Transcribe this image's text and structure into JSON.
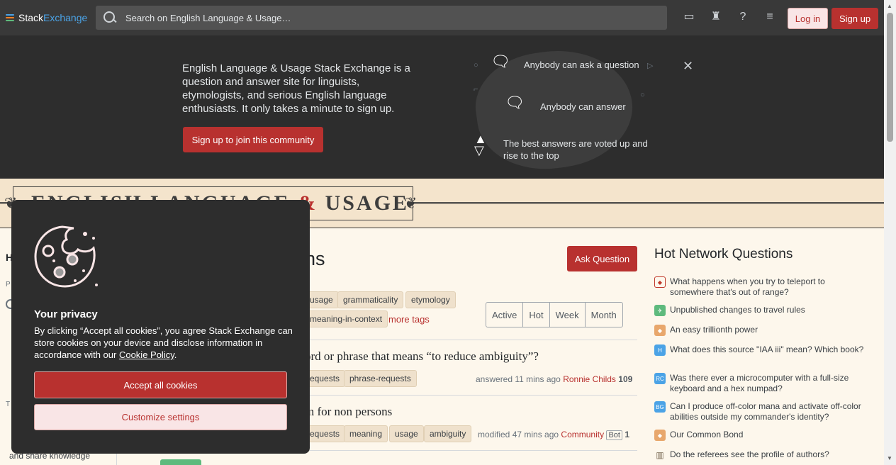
{
  "topbar": {
    "brand_part1": "Stack",
    "brand_part2": "Exchange",
    "search_placeholder": "Search on English Language & Usage…",
    "login_label": "Log in",
    "signup_label": "Sign up",
    "icons": [
      "inbox-icon",
      "achievements-icon",
      "help-icon",
      "site-switcher-icon"
    ]
  },
  "hero": {
    "text": "English Language & Usage Stack Exchange is a question and answer site for linguists, etymologists, and serious English language enthusiasts. It only takes a minute to sign up.",
    "join_label": "Sign up to join this community",
    "feature1": "Anybody can ask a question",
    "feature2": "Anybody can answer",
    "feature3": "The best answers are voted up and rise to the top"
  },
  "banner": {
    "logo_left": "ENGLISH LANGUAGE",
    "logo_amp": "&",
    "logo_right": "USAGE"
  },
  "leftnav": {
    "home_initial": "H",
    "public_initial": "P",
    "teams_initial": "T",
    "share_text": "and share knowledge"
  },
  "main": {
    "title_visible": "ns",
    "ask_label": "Ask Question",
    "tags_row1": [
      "usage",
      "grammaticality",
      "etymology"
    ],
    "tags_row2": [
      "meaning-in-context"
    ],
    "more_tags": "more tags",
    "filters": [
      "Active",
      "Hot",
      "Week",
      "Month"
    ],
    "questions": [
      {
        "title": "ord or phrase that means “to reduce ambiguity”?",
        "tags": [
          "equests",
          "phrase-requests"
        ],
        "action": "answered 11 mins ago",
        "user": "Ronnie Childs",
        "rep": "109",
        "bot": ""
      },
      {
        "title": "m for non persons",
        "tags": [
          "equests",
          "meaning",
          "usage",
          "ambiguity"
        ],
        "action": "modified 47 mins ago",
        "user": "Community",
        "rep": "1",
        "bot": "Bot"
      }
    ]
  },
  "hnq": {
    "title": "Hot Network Questions",
    "items": [
      {
        "text": "What happens when you try to teleport to somewhere that's out of range?",
        "icon": "rpg-icon",
        "color": "#c0392b"
      },
      {
        "text": "Unpublished changes to travel rules",
        "icon": "travel-icon",
        "color": "#5eba7d"
      },
      {
        "text": "An easy trillionth power",
        "icon": "codegolf-icon",
        "color": "#e8a76c"
      },
      {
        "text": "What does this source \"IAA iii\" mean? Which book?",
        "icon": "hermeneutics-icon",
        "color": "#4ba3e6"
      },
      {
        "text": "Was there ever a microcomputer with a full-size keyboard and a hex numpad?",
        "icon": "retrocomputing-icon",
        "color": "#4ba3e6"
      },
      {
        "text": "Can I produce off-color mana and activate off-color abilities outside my commander's identity?",
        "icon": "boardgames-icon",
        "color": "#4ba3e6"
      },
      {
        "text": "Our Common Bond",
        "icon": "puzzling-icon",
        "color": "#e8a76c"
      },
      {
        "text": "Do the referees see the profile of authors?",
        "icon": "academia-icon",
        "color": "#7a6a55"
      }
    ]
  },
  "cookie": {
    "title": "Your privacy",
    "body_prefix": "By clicking “Accept all cookies”, you agree Stack Exchange can store cookies on your device and disclose information in accordance with our ",
    "policy_link": "Cookie Policy",
    "body_suffix": ".",
    "accept_label": "Accept all cookies",
    "customize_label": "Customize settings"
  },
  "colors": {
    "accent": "#b8312f",
    "topbar": "#393939",
    "hero": "#2d2d2d",
    "page_bg": "#fdf7ec"
  }
}
